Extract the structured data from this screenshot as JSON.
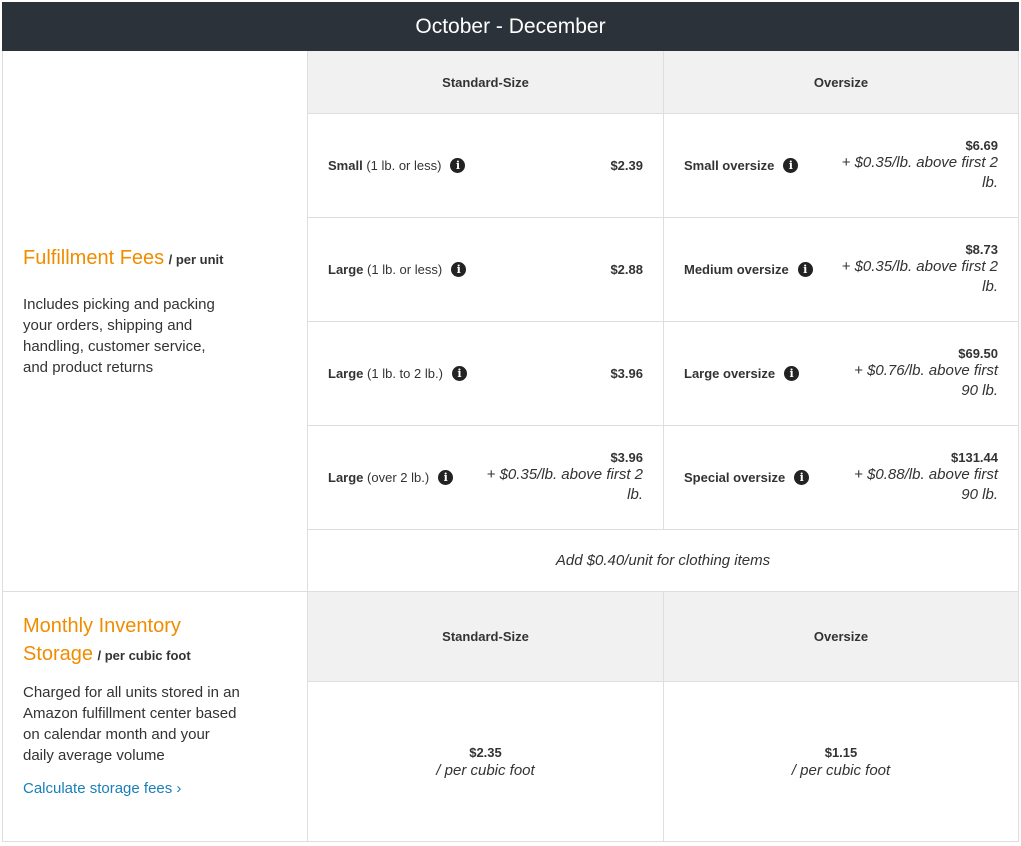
{
  "header": {
    "title": "October - December"
  },
  "fulfillment": {
    "title": "Fulfillment Fees",
    "per": "/ per unit",
    "description": "Includes picking and packing your orders, shipping and handling, customer service, and product returns",
    "col_standard": "Standard-Size",
    "col_oversize": "Oversize",
    "standard": [
      {
        "name": "Small",
        "detail": "(1 lb. or less)",
        "amount": "$2.39",
        "extra": ""
      },
      {
        "name": "Large",
        "detail": "(1 lb. or less)",
        "amount": "$2.88",
        "extra": ""
      },
      {
        "name": "Large",
        "detail": "(1 lb. to 2 lb.)",
        "amount": "$3.96",
        "extra": ""
      },
      {
        "name": "Large",
        "detail": "(over 2 lb.)",
        "amount": "$3.96",
        "extra": "+ $0.35/lb. above first 2 lb."
      }
    ],
    "oversize": [
      {
        "name": "Small oversize",
        "amount": "$6.69",
        "extra": "+ $0.35/lb. above first 2 lb."
      },
      {
        "name": "Medium oversize",
        "amount": "$8.73",
        "extra": "+ $0.35/lb. above first 2 lb."
      },
      {
        "name": "Large oversize",
        "amount": "$69.50",
        "extra": "+ $0.76/lb. above first 90 lb."
      },
      {
        "name": "Special oversize",
        "amount": "$131.44",
        "extra": "+ $0.88/lb. above first 90 lb."
      }
    ],
    "note": "Add $0.40/unit for clothing items"
  },
  "storage": {
    "title": "Monthly Inventory Storage",
    "per": "/ per cubic foot",
    "description": "Charged for all units stored in an Amazon fulfillment center based on calendar month and your daily average volume",
    "link": "Calculate storage fees ›",
    "col_standard": "Standard-Size",
    "col_oversize": "Oversize",
    "standard_amount": "$2.35",
    "oversize_amount": "$1.15",
    "unit": "/ per cubic foot"
  },
  "icons": {
    "info": "info-icon"
  },
  "colors": {
    "header_bg": "#2b3239",
    "accent": "#f08c00",
    "link": "#1a7fb8",
    "grey": "#f1f1f1"
  }
}
